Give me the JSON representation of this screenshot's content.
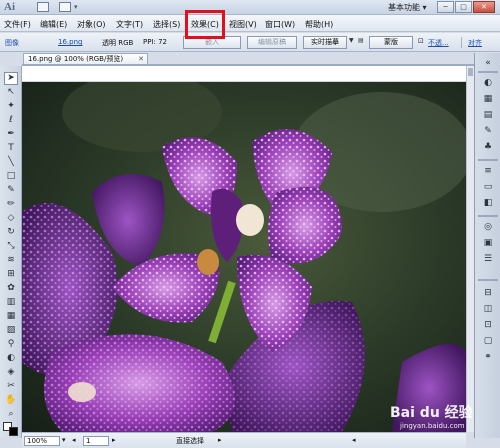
{
  "titlebar": {
    "logo": "Ai",
    "workspace": "基本功能",
    "workspace_arrow": "▾",
    "minimize": "─",
    "maximize": "□",
    "close": "✕"
  },
  "menubar": {
    "items": [
      "文件(F)",
      "编辑(E)",
      "对象(O)",
      "文字(T)",
      "选择(S)",
      "效果(C)",
      "视图(V)",
      "窗口(W)",
      "帮助(H)"
    ]
  },
  "controlbar": {
    "object_type": "图像",
    "filename": "16.png",
    "color_mode": "透明 RGB",
    "ppi": "PPI: 72",
    "embed": "嵌入",
    "edit_original": "编辑原稿",
    "live_trace": "实时描摹",
    "mask": "蒙版",
    "opacity_link": "不透...",
    "align_link": "对齐"
  },
  "document": {
    "tab_title": "16.png @ 100% (RGB/预览)",
    "tab_close": "✕"
  },
  "statusbar": {
    "zoom": "100%",
    "page": "1",
    "tool_status": "直接选择"
  },
  "watermark": {
    "brand": "Bai du 经验",
    "url": "jingyan.baidu.com"
  },
  "colors": {
    "highlight": "#e0101e",
    "link": "#1a4fb0",
    "ui_blue": "#d6dde8"
  }
}
